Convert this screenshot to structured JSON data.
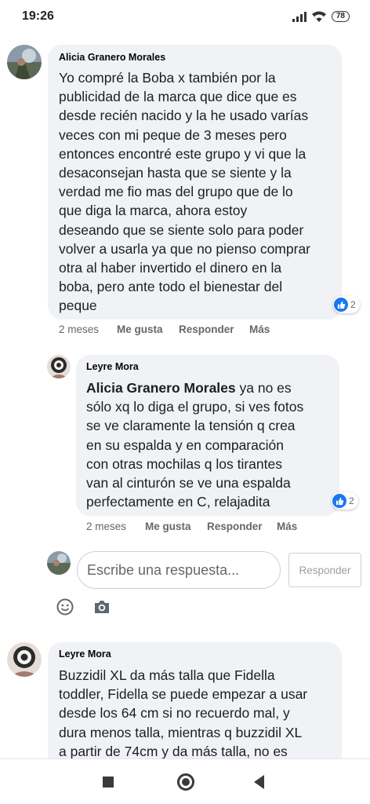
{
  "status_bar": {
    "time": "19:26",
    "battery": "78"
  },
  "comments": [
    {
      "author": "Alicia Granero Morales",
      "text": "Yo compré la Boba x también por la\npublicidad de la marca que dice que es\ndesde recién nacido y la he usado varías\nveces con mi peque de 3 meses pero\nentonces encontré este grupo y vi que la\ndesaconsejan hasta que se siente y la\nverdad me fio mas del grupo que de lo\nque diga la marca, ahora estoy\ndeseando que se siente solo para poder\nvolver a usarla ya que no pienso comprar\notra al haber invertido el dinero en la\nboba, pero ante todo el bienestar del\npeque",
      "reactions": "2",
      "time": "2 meses",
      "like_label": "Me gusta",
      "reply_label": "Responder",
      "more_label": "Más"
    },
    {
      "author": "Leyre Mora",
      "mention": "Alicia Granero Morales",
      "text": " ya no es\nsólo xq lo diga el grupo, si ves fotos\nse ve claramente la tensión q crea\nen su espalda y en comparación\ncon otras mochilas q los tirantes\nvan al cinturón se ve una espalda\nperfectamente en C, relajadita",
      "reactions": "2",
      "time": "2 meses",
      "like_label": "Me gusta",
      "reply_label": "Responder",
      "more_label": "Más"
    },
    {
      "author": "Leyre Mora",
      "text": "Buzzidil XL da más talla que Fidella\ntoddler, Fidella se puede empezar a usar\ndesde los 64 cm si no recuerdo mal, y\ndura menos talla, mientras q buzzidil XL\na partir de 74cm y da más talla, no es"
    }
  ],
  "reply_box": {
    "placeholder": "Escribe una respuesta...",
    "button_label": "Responder"
  },
  "icons": {
    "emoji": "smiley-icon",
    "camera": "camera-icon",
    "like": "thumbs-up-icon"
  },
  "colors": {
    "like_blue": "#1877f2",
    "bubble": "#f0f2f5",
    "meta_gray": "#65676b"
  }
}
